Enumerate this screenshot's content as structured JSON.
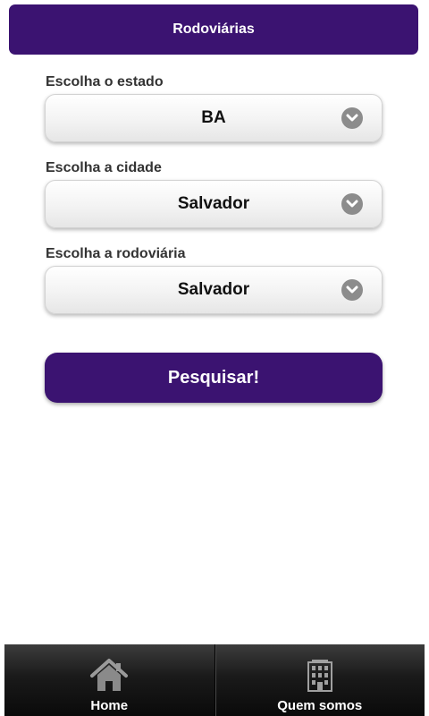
{
  "header": {
    "title": "Rodoviárias"
  },
  "form": {
    "state": {
      "label": "Escolha o estado",
      "value": "BA",
      "icon": "chevron-down-icon"
    },
    "city": {
      "label": "Escolha a cidade",
      "value": "Salvador",
      "icon": "chevron-down-icon"
    },
    "station": {
      "label": "Escolha a rodoviária",
      "value": "Salvador",
      "icon": "chevron-down-icon"
    },
    "submit_label": "Pesquisar!"
  },
  "tabbar": {
    "items": [
      {
        "label": "Home",
        "icon": "home-icon"
      },
      {
        "label": "Quem somos",
        "icon": "building-icon"
      }
    ]
  },
  "colors": {
    "brand": "#3b1371",
    "tabbar": "#1a1a1a"
  }
}
